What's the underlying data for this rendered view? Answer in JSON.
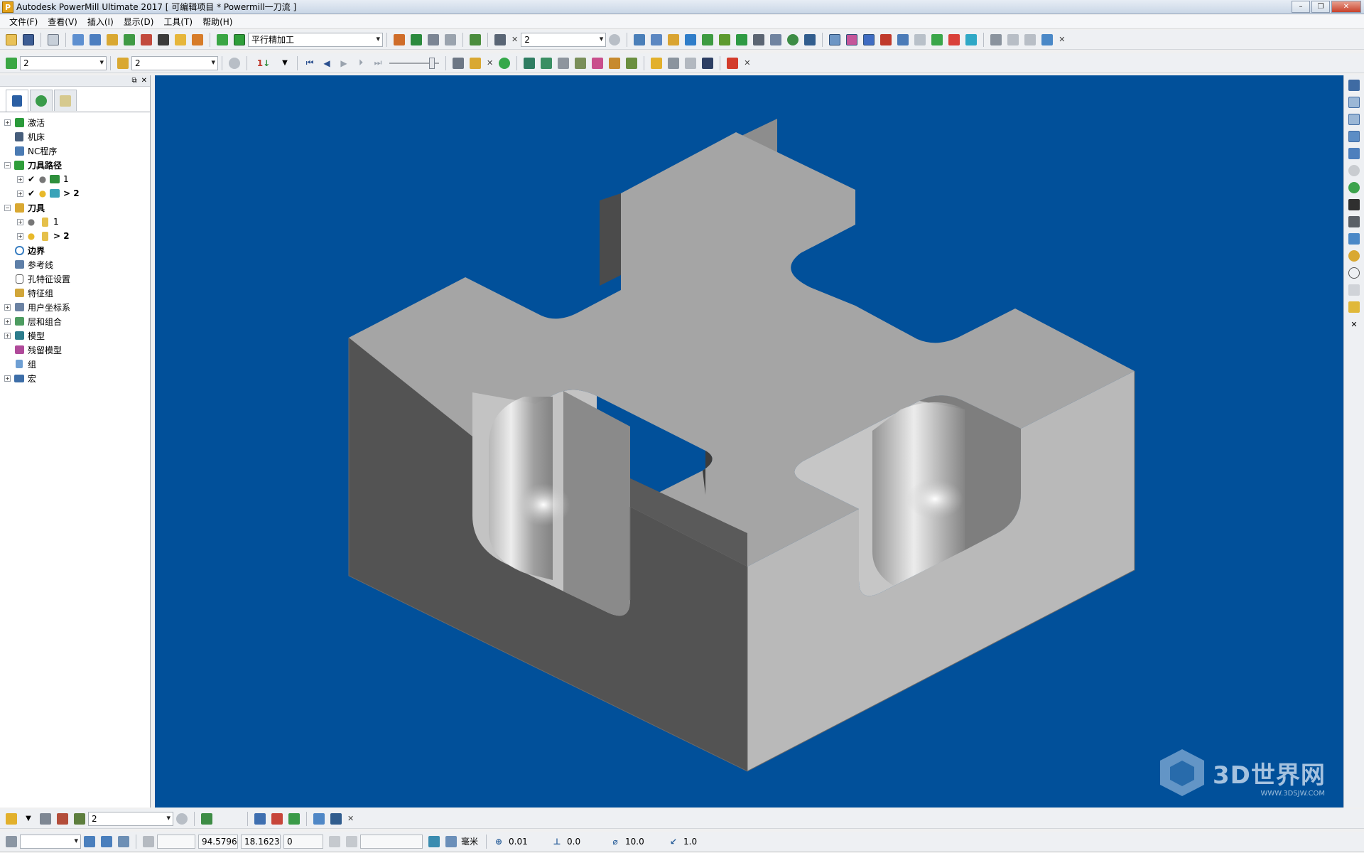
{
  "window": {
    "title": "Autodesk PowerMill Ultimate 2017    [ 可编辑项目 * Powermill一刀流 ]",
    "app_icon": "P"
  },
  "menu": [
    "文件(F)",
    "查看(V)",
    "插入(I)",
    "显示(D)",
    "工具(T)",
    "帮助(H)"
  ],
  "toolbar1": {
    "strategy_combo": "平行精加工",
    "toolpath_combo": "2"
  },
  "toolbar2": {
    "toolpath_select": "2",
    "tool_select": "2",
    "step_label": "1"
  },
  "explorer": {
    "items": [
      {
        "label": "激活",
        "bold": false
      },
      {
        "label": "机床",
        "bold": false
      },
      {
        "label": "NC程序",
        "bold": false
      },
      {
        "label": "刀具路径",
        "bold": true
      },
      {
        "label": "1",
        "bold": false
      },
      {
        "label": "> 2",
        "bold": true
      },
      {
        "label": "刀具",
        "bold": true
      },
      {
        "label": "1",
        "bold": false
      },
      {
        "label": "> 2",
        "bold": true
      },
      {
        "label": "边界",
        "bold": true
      },
      {
        "label": "参考线",
        "bold": false
      },
      {
        "label": "孔特征设置",
        "bold": false
      },
      {
        "label": "特征组",
        "bold": false
      },
      {
        "label": "用户坐标系",
        "bold": false
      },
      {
        "label": "层和组合",
        "bold": false
      },
      {
        "label": "模型",
        "bold": false
      },
      {
        "label": "残留模型",
        "bold": false
      },
      {
        "label": "组",
        "bold": false
      },
      {
        "label": "宏",
        "bold": false
      }
    ]
  },
  "bottom_toolbar": {
    "tool_combo": "2"
  },
  "status": {
    "x_coord": "94.5796",
    "y_coord": "18.1623",
    "z_coord": "0",
    "units": "毫米",
    "tolerance": "0.01",
    "thickness": "0.0",
    "diameter": "10.0",
    "stepover": "1.0"
  },
  "watermark": {
    "text": "3D世界网",
    "sub": "WWW.3DSJW.COM"
  },
  "colors": {
    "viewport_bg": "#01509a",
    "model_top": "#a4a4a4",
    "model_left": "#535353",
    "model_right": "#b9b9b9"
  }
}
